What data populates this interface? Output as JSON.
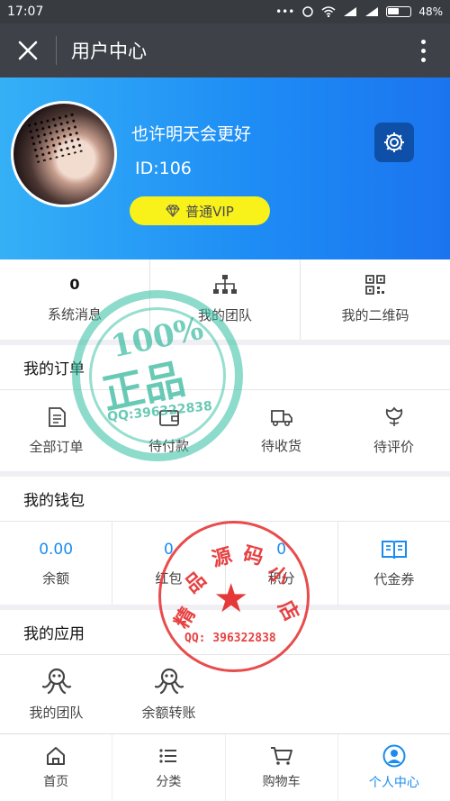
{
  "status_bar": {
    "time": "17:07",
    "dots": "•••",
    "battery": "48%"
  },
  "header": {
    "title": "用户中心"
  },
  "profile": {
    "username": "也许明天会更好",
    "user_id": "ID:106",
    "vip_label": "普通VIP"
  },
  "stats": [
    {
      "value": "0",
      "label": "系统消息"
    },
    {
      "label": "我的团队"
    },
    {
      "label": "我的二维码"
    }
  ],
  "orders": {
    "title": "我的订单",
    "items": [
      "全部订单",
      "待付款",
      "待收货",
      "待评价"
    ]
  },
  "wallet": {
    "title": "我的钱包",
    "items": [
      {
        "value": "0.00",
        "label": "余额"
      },
      {
        "value": "0",
        "label": "红包"
      },
      {
        "value": "0",
        "label": "积分"
      },
      {
        "label": "代金券"
      }
    ]
  },
  "apps": {
    "title": "我的应用",
    "items": [
      "我的团队",
      "余额转账"
    ]
  },
  "tabs": [
    {
      "label": "首页",
      "icon": "home-icon"
    },
    {
      "label": "分类",
      "icon": "list-icon"
    },
    {
      "label": "购物车",
      "icon": "cart-icon"
    },
    {
      "label": "个人中心",
      "icon": "user-icon",
      "active": true
    }
  ],
  "watermarks": {
    "green_top": "100%",
    "green_main": "正品",
    "green_qq": "QQ:396322838",
    "red_chars": [
      "精",
      "品",
      "源",
      "码",
      "小",
      "店"
    ],
    "red_qq": "QQ: 396322838"
  },
  "colors": {
    "accent": "#1a8cf0",
    "vip": "#f9f21a",
    "topbar": "#3e4148"
  }
}
